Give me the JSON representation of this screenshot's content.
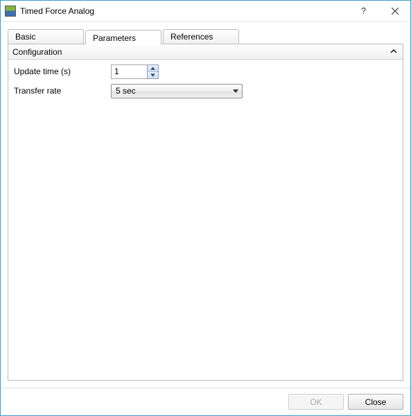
{
  "window": {
    "title": "Timed Force Analog"
  },
  "tabs": {
    "basic": "Basic",
    "parameters": "Parameters",
    "references": "References",
    "active": "parameters"
  },
  "section": {
    "title": "Configuration"
  },
  "form": {
    "update_time": {
      "label": "Update time (s)",
      "value": "1"
    },
    "transfer_rate": {
      "label": "Transfer rate",
      "value": "5 sec"
    }
  },
  "footer": {
    "ok": "OK",
    "close": "Close"
  }
}
